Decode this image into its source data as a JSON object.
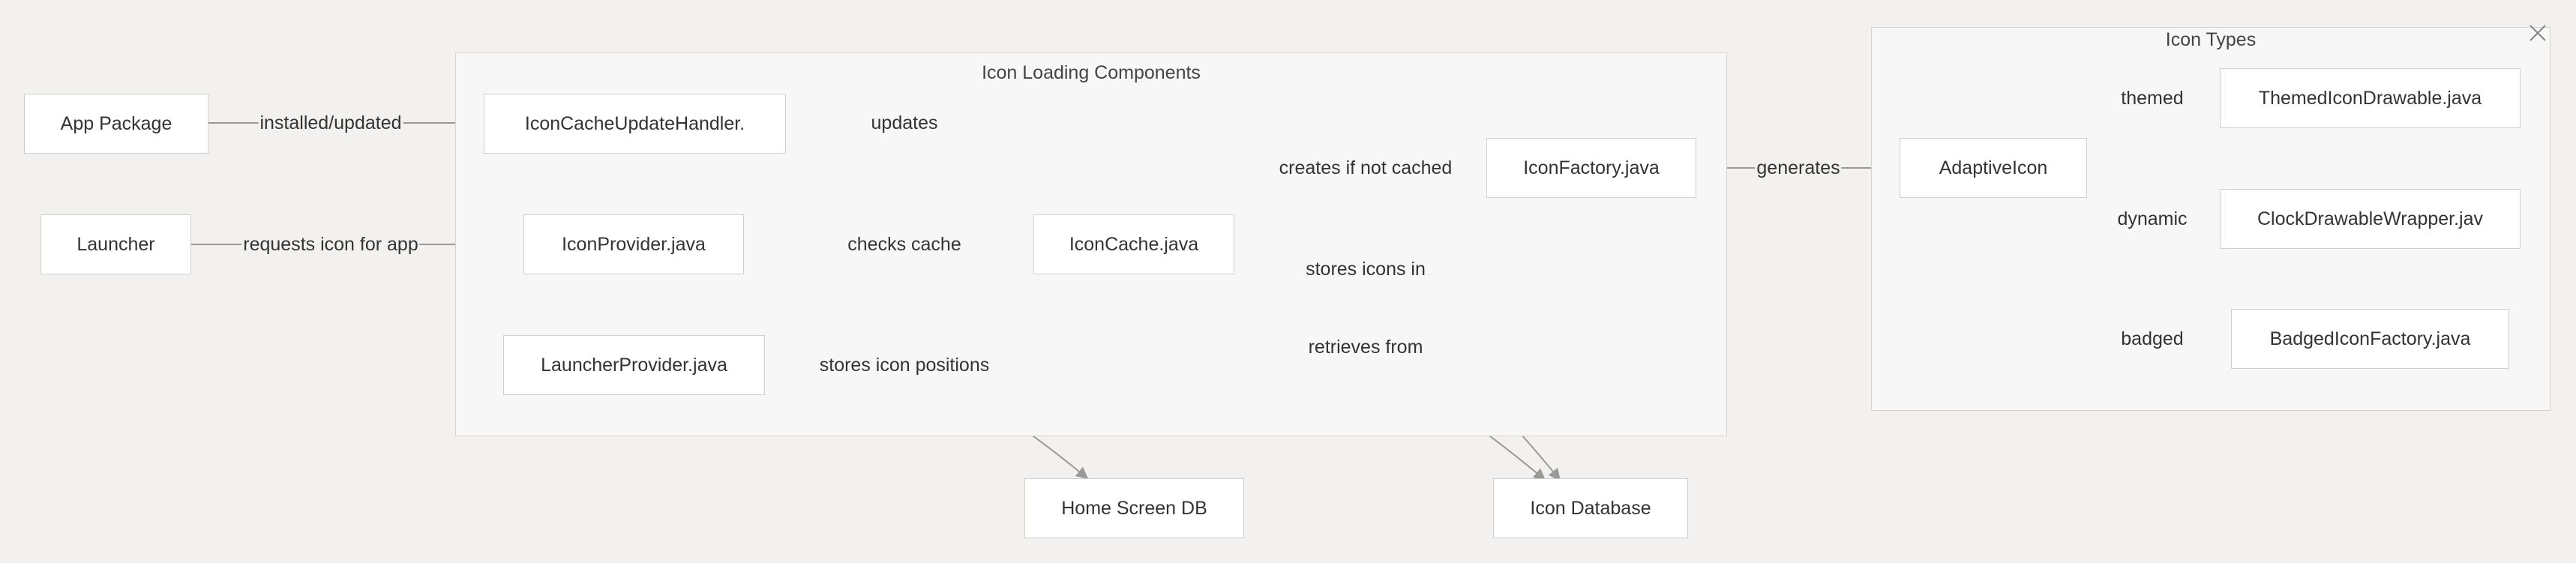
{
  "clusters": {
    "icon_loading": {
      "title": "Icon Loading Components"
    },
    "icon_types": {
      "title": "Icon Types"
    }
  },
  "nodes": {
    "app_package": "App Package",
    "launcher": "Launcher",
    "icon_cache_update_handler": "IconCacheUpdateHandler.",
    "icon_provider": "IconProvider.java",
    "launcher_provider": "LauncherProvider.java",
    "icon_cache": "IconCache.java",
    "icon_factory": "IconFactory.java",
    "home_screen_db": "Home Screen DB",
    "icon_database": "Icon Database",
    "adaptive_icon": "AdaptiveIcon",
    "themed_icon_drawable": "ThemedIconDrawable.java",
    "clock_drawable_wrapper": "ClockDrawableWrapper.jav",
    "badged_icon_factory": "BadgedIconFactory.java"
  },
  "edges": {
    "installed_updated": "installed/updated",
    "requests_icon": "requests icon for app",
    "updates": "updates",
    "checks_cache": "checks cache",
    "creates_if_not_cached": "creates if not cached",
    "stores_icons_in": "stores icons in",
    "retrieves_from": "retrieves from",
    "stores_icon_positions": "stores icon positions",
    "generates": "generates",
    "themed": "themed",
    "dynamic": "dynamic",
    "badged": "badged"
  },
  "colors": {
    "background": "#f2f1f0",
    "cluster_fill": "#f7f7f7",
    "node_fill": "#ffffff",
    "edge_stroke": "#999999"
  },
  "icons": {
    "close": "close-icon"
  }
}
